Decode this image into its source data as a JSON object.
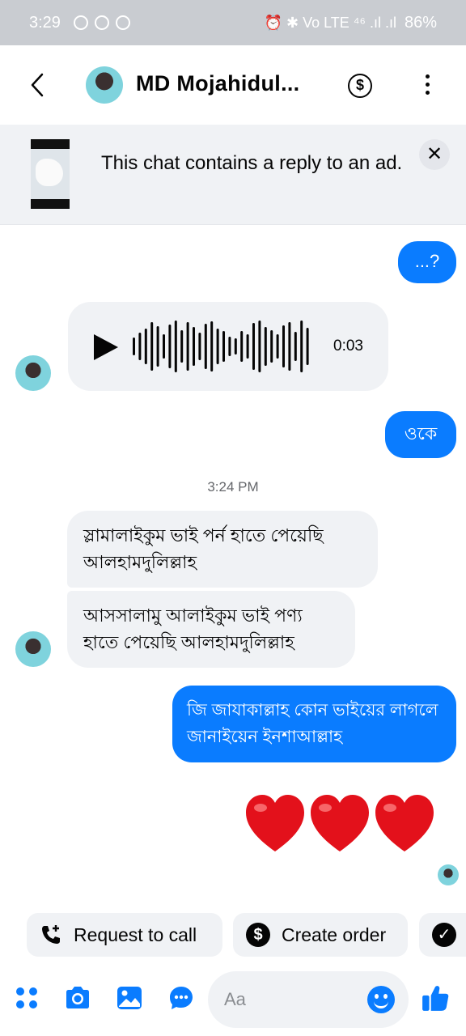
{
  "status_bar": {
    "time": "3:29",
    "indicators": "⏰ ✱ Vo LTE ⁴⁶ .ıl .ıl",
    "battery": "86%"
  },
  "header": {
    "contact_name": "MD Mojahidul...",
    "dollar_symbol": "$"
  },
  "ad_banner": {
    "text": "This chat contains a reply to an ad.",
    "close_symbol": "✕"
  },
  "messages": {
    "outgoing_question": "...?",
    "voice_duration": "0:03",
    "outgoing_ok": "ওকে",
    "timestamp": "3:24 PM",
    "incoming_1": "স্লামালাইকুম ভাই পর্ন হাতে পেয়েছি আলহামদুলিল্লাহ",
    "incoming_2": "আসসালামু আলাইকুম ভাই পণ্য হাতে পেয়েছি আলহামদুলিল্লাহ",
    "outgoing_reply": "জি জাযাকাল্লাহ কোন ভাইয়ের লাগলে জানাইয়েন ইনশাআল্লাহ",
    "hearts": "❤️❤️❤️"
  },
  "quick_actions": {
    "request_call": "Request to call",
    "create_order": "Create order",
    "dollar_symbol": "$",
    "check_symbol": "✓"
  },
  "composer": {
    "placeholder": "Aa"
  },
  "colors": {
    "accent": "#0a7cff",
    "incoming_bubble": "#f0f2f5",
    "status_bar": "#c9ccd1"
  }
}
